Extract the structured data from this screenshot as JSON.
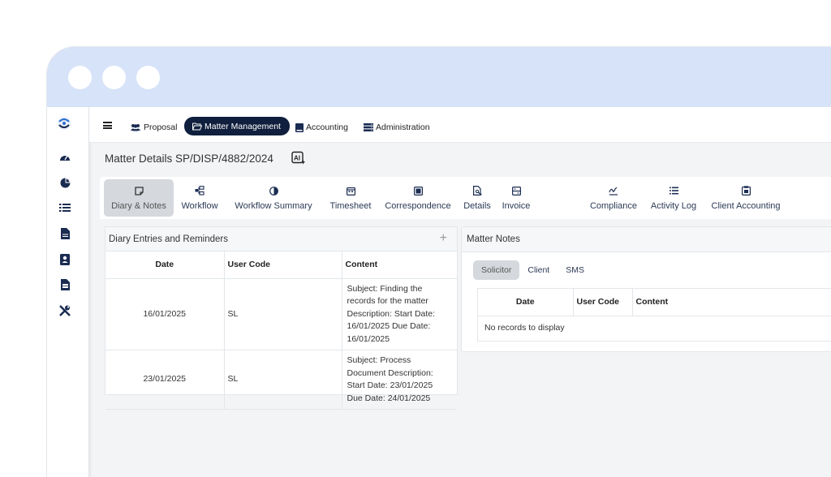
{
  "window": {
    "controls": [
      "dot",
      "dot",
      "dot"
    ]
  },
  "sidebar": {
    "logo": "app-logo",
    "icons": [
      "dashboard-icon",
      "pie-chart-icon",
      "list-icon",
      "document-icon",
      "contact-card-icon",
      "report-icon",
      "tools-icon"
    ]
  },
  "topnav": {
    "items": [
      {
        "label": "Proposal",
        "icon": "users-icon"
      },
      {
        "label": "Matter Management",
        "icon": "folder-open-icon"
      },
      {
        "label": "Accounting",
        "icon": "book-icon"
      },
      {
        "label": "Administration",
        "icon": "server-icon"
      }
    ]
  },
  "page": {
    "title": "Matter Details SP/DISP/4882/2024"
  },
  "tabs": [
    {
      "label": "Diary & Notes"
    },
    {
      "label": "Workflow"
    },
    {
      "label": "Workflow Summary"
    },
    {
      "label": "Timesheet"
    },
    {
      "label": "Correspondence"
    },
    {
      "label": "Details"
    },
    {
      "label": "Invoice"
    },
    {
      "label": "Compliance"
    },
    {
      "label": "Activity Log"
    },
    {
      "label": "Client Accounting"
    }
  ],
  "diary": {
    "title": "Diary Entries and Reminders",
    "add_label": "+",
    "columns": [
      "Date",
      "User Code",
      "Content"
    ],
    "rows": [
      {
        "date": "16/01/2025",
        "user": "SL",
        "content": "Subject: Finding the records for the matter Description: Start Date: 16/01/2025 Due Date: 16/01/2025"
      },
      {
        "date": "23/01/2025",
        "user": "SL",
        "content": "Subject: Process Document Description: Start Date: 23/01/2025 Due Date: 24/01/2025"
      }
    ]
  },
  "notes": {
    "title": "Matter Notes",
    "subtabs": [
      "Solicitor",
      "Client",
      "SMS"
    ],
    "columns": [
      "Date",
      "User Code",
      "Content"
    ],
    "empty": "No records to display"
  },
  "colors": {
    "accent": "#0f1f3d",
    "titlebar": "#d6e3f8",
    "active_tab": "#d5d8dd"
  }
}
